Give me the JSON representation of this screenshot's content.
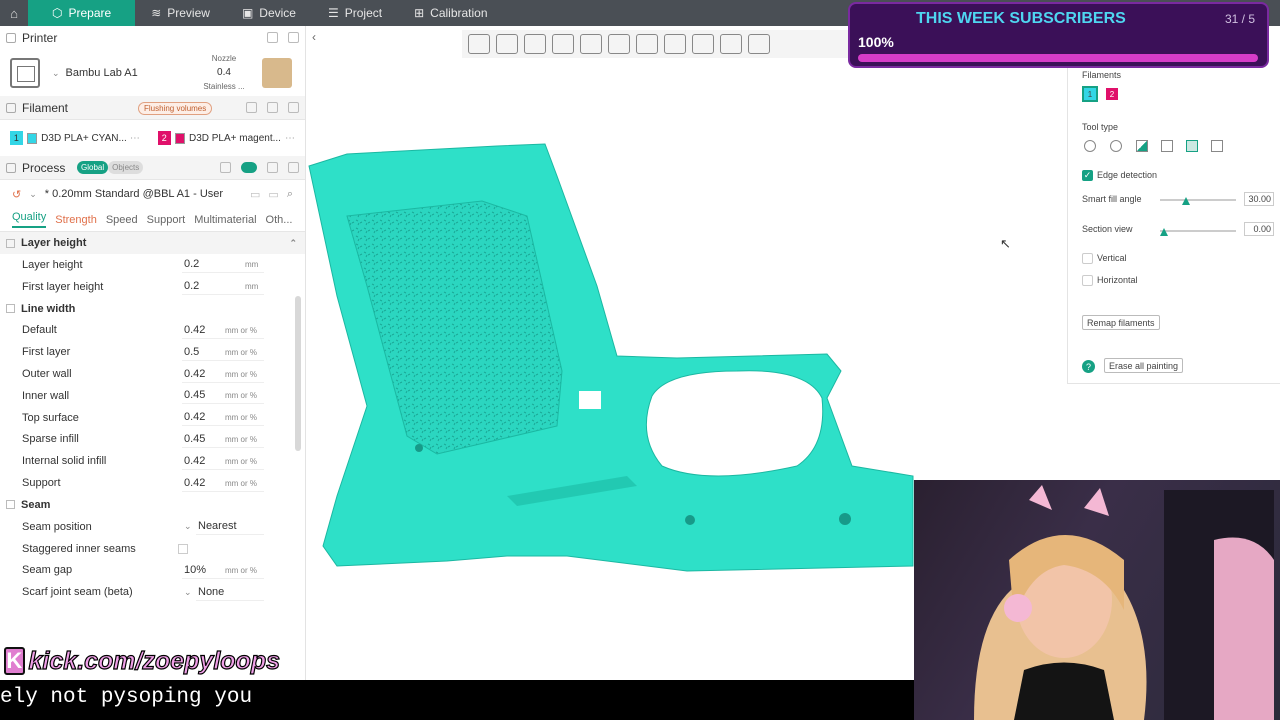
{
  "topbar": {
    "tabs": [
      {
        "label": "Prepare",
        "icon": "cube-icon",
        "active": true
      },
      {
        "label": "Preview",
        "icon": "layers-icon",
        "active": false
      },
      {
        "label": "Device",
        "icon": "device-icon",
        "active": false
      },
      {
        "label": "Project",
        "icon": "project-icon",
        "active": false
      },
      {
        "label": "Calibration",
        "icon": "calibration-icon",
        "active": false
      }
    ]
  },
  "printer": {
    "section_label": "Printer",
    "name": "Bambu Lab A1",
    "nozzle_label": "Nozzle",
    "nozzle_value": "0.4",
    "nozzle_material": "Stainless ..."
  },
  "filament": {
    "section_label": "Filament",
    "badge": "Flushing volumes",
    "items": [
      {
        "num": "1",
        "name": "D3D PLA+ CYAN...",
        "color": "#33d6e6"
      },
      {
        "num": "2",
        "name": "D3D PLA+ magent...",
        "color": "#e0106a"
      }
    ]
  },
  "process": {
    "section_label": "Process",
    "toggle_global": "Global",
    "toggle_objects": "Objects",
    "preset": "* 0.20mm Standard @BBL A1 - User",
    "tabs": [
      "Quality",
      "Strength",
      "Speed",
      "Support",
      "Multimaterial",
      "Oth..."
    ]
  },
  "params": {
    "layer_height_group": "Layer height",
    "layer_height": {
      "label": "Layer height",
      "value": "0.2",
      "unit": "mm"
    },
    "first_layer_height": {
      "label": "First layer height",
      "value": "0.2",
      "unit": "mm"
    },
    "line_width_group": "Line width",
    "default": {
      "label": "Default",
      "value": "0.42",
      "unit": "mm or %"
    },
    "first_layer": {
      "label": "First layer",
      "value": "0.5",
      "unit": "mm or %"
    },
    "outer_wall": {
      "label": "Outer wall",
      "value": "0.42",
      "unit": "mm or %"
    },
    "inner_wall": {
      "label": "Inner wall",
      "value": "0.45",
      "unit": "mm or %"
    },
    "top_surface": {
      "label": "Top surface",
      "value": "0.42",
      "unit": "mm or %"
    },
    "sparse_infill": {
      "label": "Sparse infill",
      "value": "0.45",
      "unit": "mm or %"
    },
    "internal_solid_infill": {
      "label": "Internal solid infill",
      "value": "0.42",
      "unit": "mm or %"
    },
    "support": {
      "label": "Support",
      "value": "0.42",
      "unit": "mm or %"
    },
    "seam_group": "Seam",
    "seam_position": {
      "label": "Seam position",
      "value": "Nearest"
    },
    "staggered_inner_seams": {
      "label": "Staggered inner seams"
    },
    "seam_gap": {
      "label": "Seam gap",
      "value": "10%",
      "unit": "mm or %"
    },
    "scarf_joint": {
      "label": "Scarf joint seam (beta)",
      "value": "None"
    }
  },
  "paint_panel": {
    "filaments_label": "Filaments",
    "filament_nums": [
      "1",
      "2"
    ],
    "tool_type_label": "Tool type",
    "edge_detection": "Edge detection",
    "smart_fill_angle_label": "Smart fill angle",
    "smart_fill_angle_value": "30.00",
    "section_view_label": "Section view",
    "section_view_value": "0.00",
    "vertical": "Vertical",
    "horizontal": "Horizontal",
    "remap_button": "Remap filaments",
    "erase_button": "Erase all painting",
    "help_icon": "?"
  },
  "overlay": {
    "subs_title": "THIS WEEK SUBSCRIBERS",
    "subs_count": "31 / 5",
    "subs_percent": "100%",
    "kick_url": "kick.com/zoepyloops",
    "kick_logo": "K",
    "caption": "ely not pysoping you"
  },
  "colors": {
    "accent": "#16a184",
    "model": "#2ee0c8",
    "cyan": "#33d6e6",
    "magenta": "#e0106a"
  }
}
